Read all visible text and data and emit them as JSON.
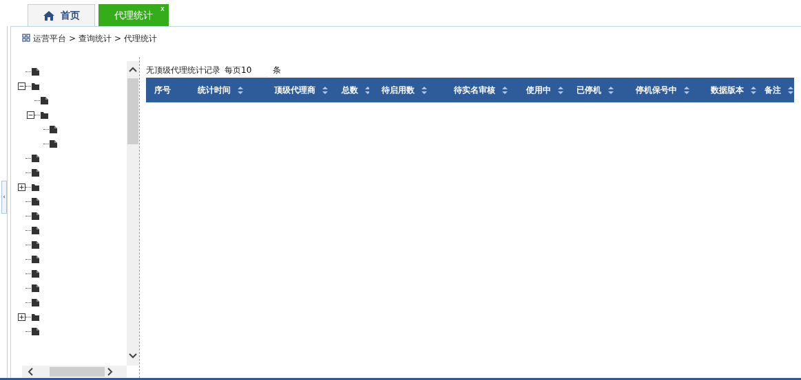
{
  "tabs": [
    {
      "label": "首页",
      "selected": false
    },
    {
      "label": "代理统计",
      "close": "x",
      "selected": true
    }
  ],
  "collapse_handle": "‹",
  "breadcrumb": [
    "运营平台",
    ">",
    "查询统计",
    ">",
    "代理统计"
  ],
  "tree": [
    {
      "kind": "file"
    },
    {
      "kind": "folder",
      "expanded": true,
      "children": [
        {
          "kind": "file"
        },
        {
          "kind": "folder",
          "expanded": true,
          "children": [
            {
              "kind": "file"
            },
            {
              "kind": "file"
            }
          ]
        }
      ]
    },
    {
      "kind": "file"
    },
    {
      "kind": "file"
    },
    {
      "kind": "folder",
      "expanded": false
    },
    {
      "kind": "file"
    },
    {
      "kind": "file"
    },
    {
      "kind": "file"
    },
    {
      "kind": "file"
    },
    {
      "kind": "file"
    },
    {
      "kind": "file"
    },
    {
      "kind": "file"
    },
    {
      "kind": "file"
    },
    {
      "kind": "folder",
      "expanded": false
    },
    {
      "kind": "file"
    }
  ],
  "status": {
    "message": "无顶级代理统计记录",
    "per_page_label": "每页",
    "per_page": "10",
    "unit": "条"
  },
  "table": {
    "columns": [
      {
        "label": "序号",
        "sortable": false
      },
      {
        "label": "统计时间",
        "sortable": true
      },
      {
        "label": "顶级代理商",
        "sortable": true
      },
      {
        "label": "总数",
        "sortable": true
      },
      {
        "label": "待启用数",
        "sortable": true
      },
      {
        "label": "待实名审核",
        "sortable": true
      },
      {
        "label": "使用中",
        "sortable": true
      },
      {
        "label": "已停机",
        "sortable": true
      },
      {
        "label": "停机保号中",
        "sortable": true
      },
      {
        "label": "数据版本",
        "sortable": true
      },
      {
        "label": "备注",
        "sortable": true
      }
    ]
  }
}
